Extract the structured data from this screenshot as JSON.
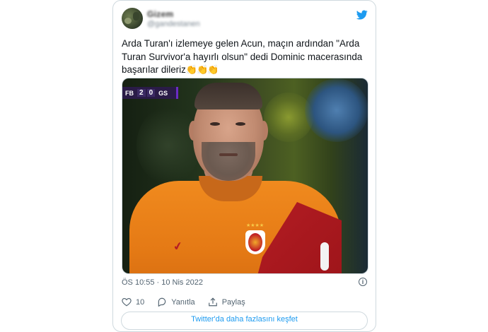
{
  "tweet": {
    "author_name": "Gizem",
    "author_handle": "@gandestanen",
    "text": "Arda Turan'ı izlemeye gelen Acun, maçın ardından \"Arda Turan Survivor'a hayırlı olsun\" dedi Dominic macerasında başarılar dileriz",
    "emojis": "👏👏👏",
    "timestamp": "ÖS 10:55 · 10 Nis 2022",
    "like_count": "10",
    "reply_label": "Yanıtla",
    "share_label": "Paylaş",
    "more_label": "Twitter'da daha fazlasını keşfet"
  },
  "media": {
    "scoreboard": {
      "home_team": "FB",
      "home_score": "2",
      "away_score": "0",
      "away_team": "GS"
    }
  },
  "colors": {
    "twitter_blue": "#1d9bf0",
    "muted_text": "#536471",
    "border": "#cfd9de",
    "jersey_orange": "#f08a1e",
    "jersey_red": "#b51d24"
  },
  "icons": [
    "twitter-bird-icon",
    "info-icon",
    "heart-icon",
    "reply-icon",
    "share-icon"
  ]
}
